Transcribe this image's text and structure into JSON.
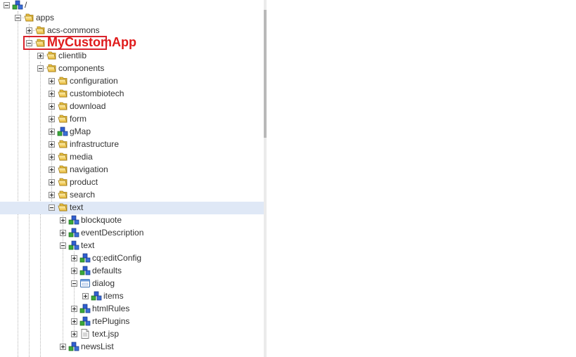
{
  "tree": {
    "root": "/",
    "apps": "apps",
    "acs_commons": "acs-commons",
    "my_custom_app": "MyCustomApp",
    "clientlib": "clientlib",
    "components": "components",
    "configuration": "configuration",
    "custombiotech": "custombiotech",
    "download": "download",
    "form": "form",
    "gmap": "gMap",
    "infrastructure": "infrastructure",
    "media": "media",
    "navigation": "navigation",
    "product": "product",
    "search": "search",
    "text_folder": "text",
    "blockquote": "blockquote",
    "event_description": "eventDescription",
    "text_node": "text",
    "cq_edit_config": "cq:editConfig",
    "defaults": "defaults",
    "dialog": "dialog",
    "items": "items",
    "html_rules": "htmlRules",
    "rte_plugins": "rtePlugins",
    "text_jsp": "text.jsp",
    "news_list": "newsList"
  },
  "icons": {
    "folder": "folder-icon",
    "node": "node-icon",
    "dialog": "dialog-icon",
    "file": "file-icon"
  },
  "colors": {
    "highlight": "#e01b1b",
    "selected_row": "#dfe8f6",
    "folder": "#f2cf52"
  }
}
